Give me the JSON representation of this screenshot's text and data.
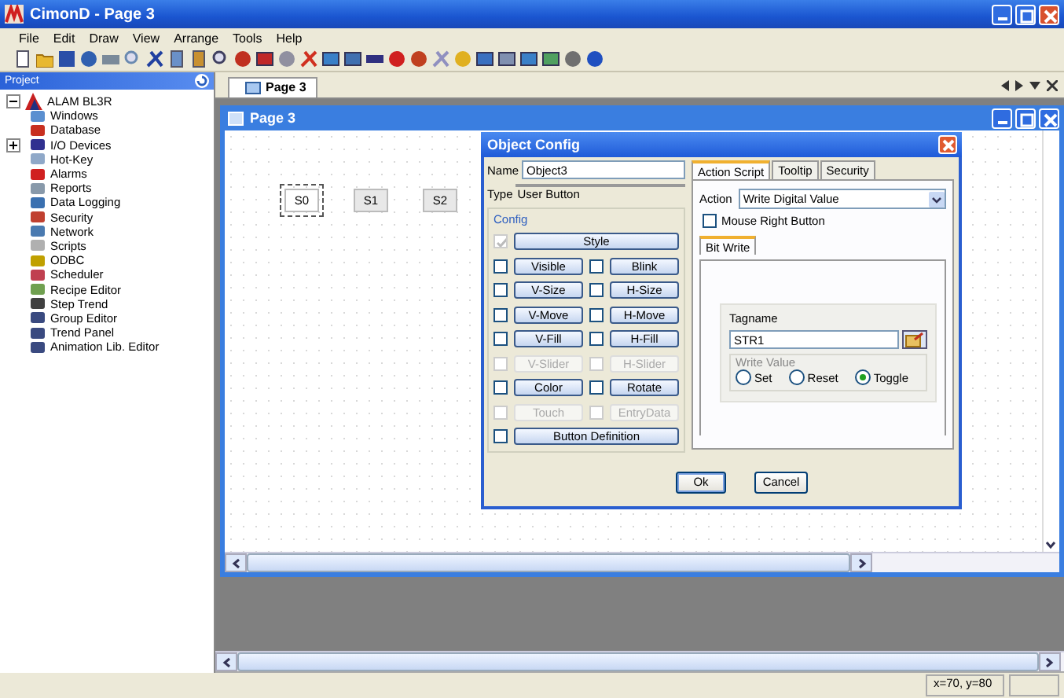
{
  "window": {
    "title": "CimonD - Page 3"
  },
  "menu": [
    "File",
    "Edit",
    "Draw",
    "View",
    "Arrange",
    "Tools",
    "Help"
  ],
  "project": {
    "title": "Project",
    "tree": [
      {
        "label": "ALAM BL3R",
        "expanded": true,
        "children": [
          {
            "label": "Windows"
          },
          {
            "label": "Database"
          },
          {
            "label": "I/O Devices",
            "expanded": false
          },
          {
            "label": "Hot-Key"
          },
          {
            "label": "Alarms"
          },
          {
            "label": "Reports"
          },
          {
            "label": "Data Logging"
          },
          {
            "label": "Security"
          },
          {
            "label": "Network"
          },
          {
            "label": "Scripts"
          },
          {
            "label": "ODBC"
          },
          {
            "label": "Scheduler"
          },
          {
            "label": "Recipe Editor"
          },
          {
            "label": "Step Trend"
          },
          {
            "label": "Group Editor"
          },
          {
            "label": "Trend Panel"
          },
          {
            "label": "Animation Lib. Editor"
          }
        ]
      }
    ]
  },
  "document_tabs": [
    {
      "label": "Page 3",
      "selected": true
    }
  ],
  "page_window": {
    "title": "Page 3",
    "objects": [
      {
        "label": "S0",
        "selected": true
      },
      {
        "label": "S1",
        "selected": false
      },
      {
        "label": "S2",
        "selected": false
      }
    ]
  },
  "dialog": {
    "title": "Object Config",
    "name_label": "Name",
    "name_value": "Object3",
    "type_label": "Type",
    "type_value": "User Button",
    "config_label": "Config",
    "config_rows": [
      {
        "items": [
          {
            "label": "Style",
            "checked": true,
            "disabled": false,
            "checkbox_disabled": true
          }
        ]
      },
      {
        "items": [
          {
            "label": "Visible",
            "checked": false,
            "disabled": false
          },
          {
            "label": "Blink",
            "checked": false,
            "disabled": false
          }
        ]
      },
      {
        "items": [
          {
            "label": "V-Size",
            "checked": false,
            "disabled": false
          },
          {
            "label": "H-Size",
            "checked": false,
            "disabled": false
          }
        ]
      },
      {
        "items": [
          {
            "label": "V-Move",
            "checked": false,
            "disabled": false
          },
          {
            "label": "H-Move",
            "checked": false,
            "disabled": false
          }
        ]
      },
      {
        "items": [
          {
            "label": "V-Fill",
            "checked": false,
            "disabled": false
          },
          {
            "label": "H-Fill",
            "checked": false,
            "disabled": false
          }
        ]
      },
      {
        "items": [
          {
            "label": "V-Slider",
            "checked": false,
            "disabled": true
          },
          {
            "label": "H-Slider",
            "checked": false,
            "disabled": true
          }
        ]
      },
      {
        "items": [
          {
            "label": "Color",
            "checked": false,
            "disabled": false
          },
          {
            "label": "Rotate",
            "checked": false,
            "disabled": false
          }
        ]
      },
      {
        "items": [
          {
            "label": "Touch",
            "checked": false,
            "disabled": true
          },
          {
            "label": "EntryData",
            "checked": false,
            "disabled": true
          }
        ]
      },
      {
        "items": [
          {
            "label": "Button Definition",
            "checked": false,
            "disabled": false
          }
        ]
      }
    ],
    "tabs": [
      {
        "label": "Action Script",
        "selected": true
      },
      {
        "label": "Tooltip",
        "selected": false
      },
      {
        "label": "Security",
        "selected": false
      }
    ],
    "action_label": "Action",
    "action_value": "Write Digital Value",
    "mouse_right_button": {
      "label": "Mouse Right Button",
      "checked": false
    },
    "sub_tabs": [
      {
        "label": "Bit Write",
        "selected": true
      }
    ],
    "tagname_label": "Tagname",
    "tagname_value": "STR1",
    "write_value_label": "Write Value",
    "write_values": [
      {
        "label": "Set",
        "selected": false
      },
      {
        "label": "Reset",
        "selected": false
      },
      {
        "label": "Toggle",
        "selected": true
      }
    ],
    "buttons": [
      "Ok",
      "Cancel"
    ]
  },
  "status_bar": {
    "coordinates": "x=70, y=80"
  }
}
